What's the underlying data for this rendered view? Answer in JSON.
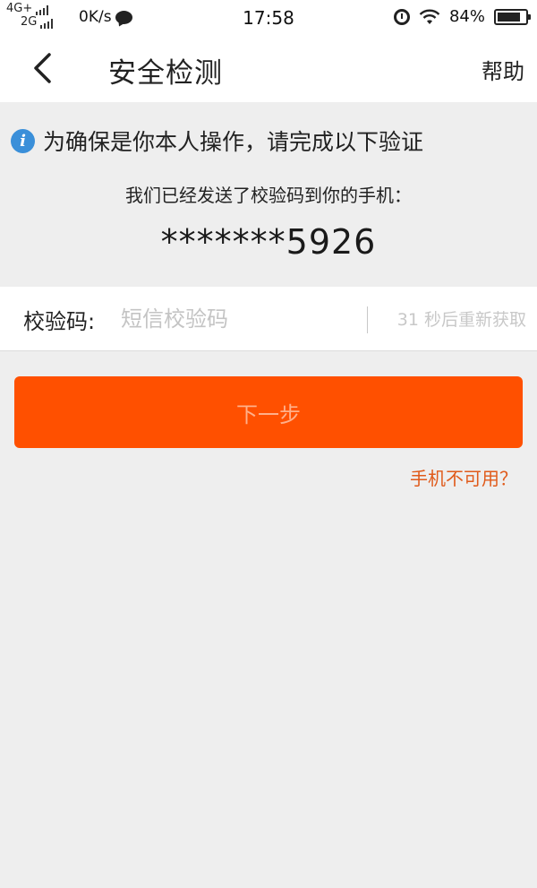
{
  "status_bar": {
    "net_top": "4G+",
    "net_bottom": "2G",
    "speed": "0K/s",
    "time": "17:58",
    "battery": "84%",
    "battery_level": 0.84,
    "icons": [
      "signal-icon",
      "chat-bubble-icon",
      "alarm-icon",
      "wifi-icon",
      "battery-icon"
    ]
  },
  "nav": {
    "back_icon": "back-chevron-icon",
    "title": "安全检测",
    "help": "帮助"
  },
  "info": {
    "icon": "info-icon",
    "icon_glyph": "i",
    "notice": "为确保是你本人操作，请完成以下验证",
    "sent_text": "我们已经发送了校验码到你的手机：",
    "phone": "*******5926"
  },
  "code": {
    "label": "校验码:",
    "placeholder": "短信校验码",
    "value": "",
    "resend": "31 秒后重新获取"
  },
  "actions": {
    "next": "下一步",
    "phone_unavailable": "手机不可用？"
  },
  "colors": {
    "accent": "#ff5000",
    "link": "#e05a1a",
    "info_icon": "#3a8fd9",
    "background": "#eeeeee"
  }
}
